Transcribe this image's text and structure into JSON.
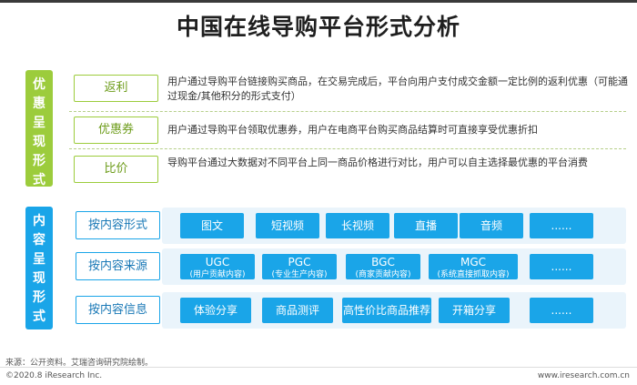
{
  "title": "中国在线导购平台形式分析",
  "section1": {
    "side_chars": [
      "优",
      "惠",
      "呈",
      "现",
      "形",
      "式"
    ],
    "rows": [
      {
        "label": "返利",
        "desc": "用户通过导购平台链接购买商品，在交易完成后，平台向用户支付成交金额一定比例的返利优惠（可能通过现金/其他积分的形式支付）"
      },
      {
        "label": "优惠券",
        "desc": "用户通过导购平台领取优惠券，用户在电商平台购买商品结算时可直接享受优惠折扣"
      },
      {
        "label": "比价",
        "desc": "导购平台通过大数据对不同平台上同一商品价格进行对比，用户可以自主选择最优惠的平台消费"
      }
    ]
  },
  "section2": {
    "side_chars": [
      "内",
      "容",
      "呈",
      "现",
      "形",
      "式"
    ],
    "rows": [
      {
        "label": "按内容形式",
        "chips": [
          "图文",
          "短视频",
          "长视频",
          "直播",
          "音频",
          "......"
        ]
      },
      {
        "label": "按内容来源",
        "chips": [
          {
            "main": "UGC",
            "sub": "(用户贡献内容)"
          },
          {
            "main": "PGC",
            "sub": "(专业生产内容)"
          },
          {
            "main": "BGC",
            "sub": "(商家贡献内容)"
          },
          {
            "main": "MGC",
            "sub": "(系统直接抓取内容)"
          },
          {
            "main": "......",
            "sub": ""
          }
        ]
      },
      {
        "label": "按内容信息",
        "chips": [
          "体验分享",
          "商品测评",
          "高性价比商品推荐",
          "开箱分享",
          "......"
        ]
      }
    ]
  },
  "footer": {
    "source": "来源：公开资料。艾瑞咨询研究院绘制。",
    "copyright": "©2020.8 iResearch Inc.",
    "website": "www.iresearch.com.cn"
  },
  "colors": {
    "green_accent": "#9ccc3c",
    "blue_accent": "#1aa5e8",
    "track_bg": "#eaf4fb"
  }
}
